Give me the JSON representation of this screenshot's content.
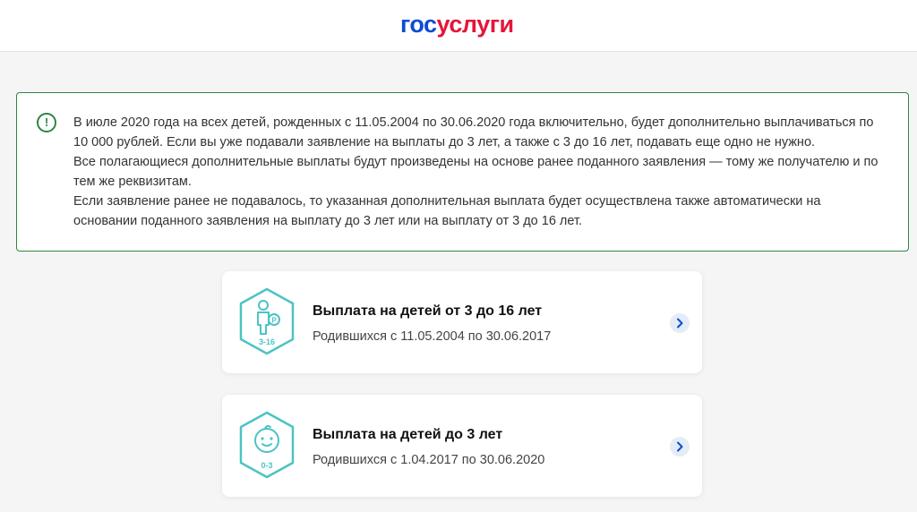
{
  "header": {
    "logo_part1": "гос",
    "logo_part2": "услуги"
  },
  "notice": {
    "icon": "exclamation-circle-icon",
    "paragraphs": [
      "В июле 2020 года на всех детей, рожденных с 11.05.2004 по 30.06.2020 года включительно, будет дополнительно выплачиваться по 10 000 рублей. Если вы уже подавали заявление на выплаты до 3 лет, а также с 3 до 16 лет, подавать еще одно не нужно.",
      "Все полагающиеся дополнительные выплаты будут произведены на основе ранее поданного заявления — тому же получателю и по тем же реквизитам.",
      "Если заявление ранее не подавалось, то указанная дополнительная выплата будет осуществлена также автоматически на основании поданного заявления на выплату до 3 лет или на выплату от 3 до 16 лет."
    ]
  },
  "cards": [
    {
      "icon": "child-coin-icon",
      "badge": "3-16",
      "title": "Выплата на детей от 3 до 16 лет",
      "subtitle": "Родившихся с 11.05.2004 по 30.06.2017"
    },
    {
      "icon": "baby-face-icon",
      "badge": "0-3",
      "title": "Выплата на детей до 3 лет",
      "subtitle": "Родившихся с 1.04.2017 по 30.06.2020"
    }
  ],
  "colors": {
    "brand_blue": "#0d4cd3",
    "brand_red": "#e4163a",
    "notice_green": "#2e8540",
    "icon_teal": "#4cc3c5",
    "chevron_bg": "#e4ecf7",
    "chevron_fg": "#0d4cd3"
  }
}
